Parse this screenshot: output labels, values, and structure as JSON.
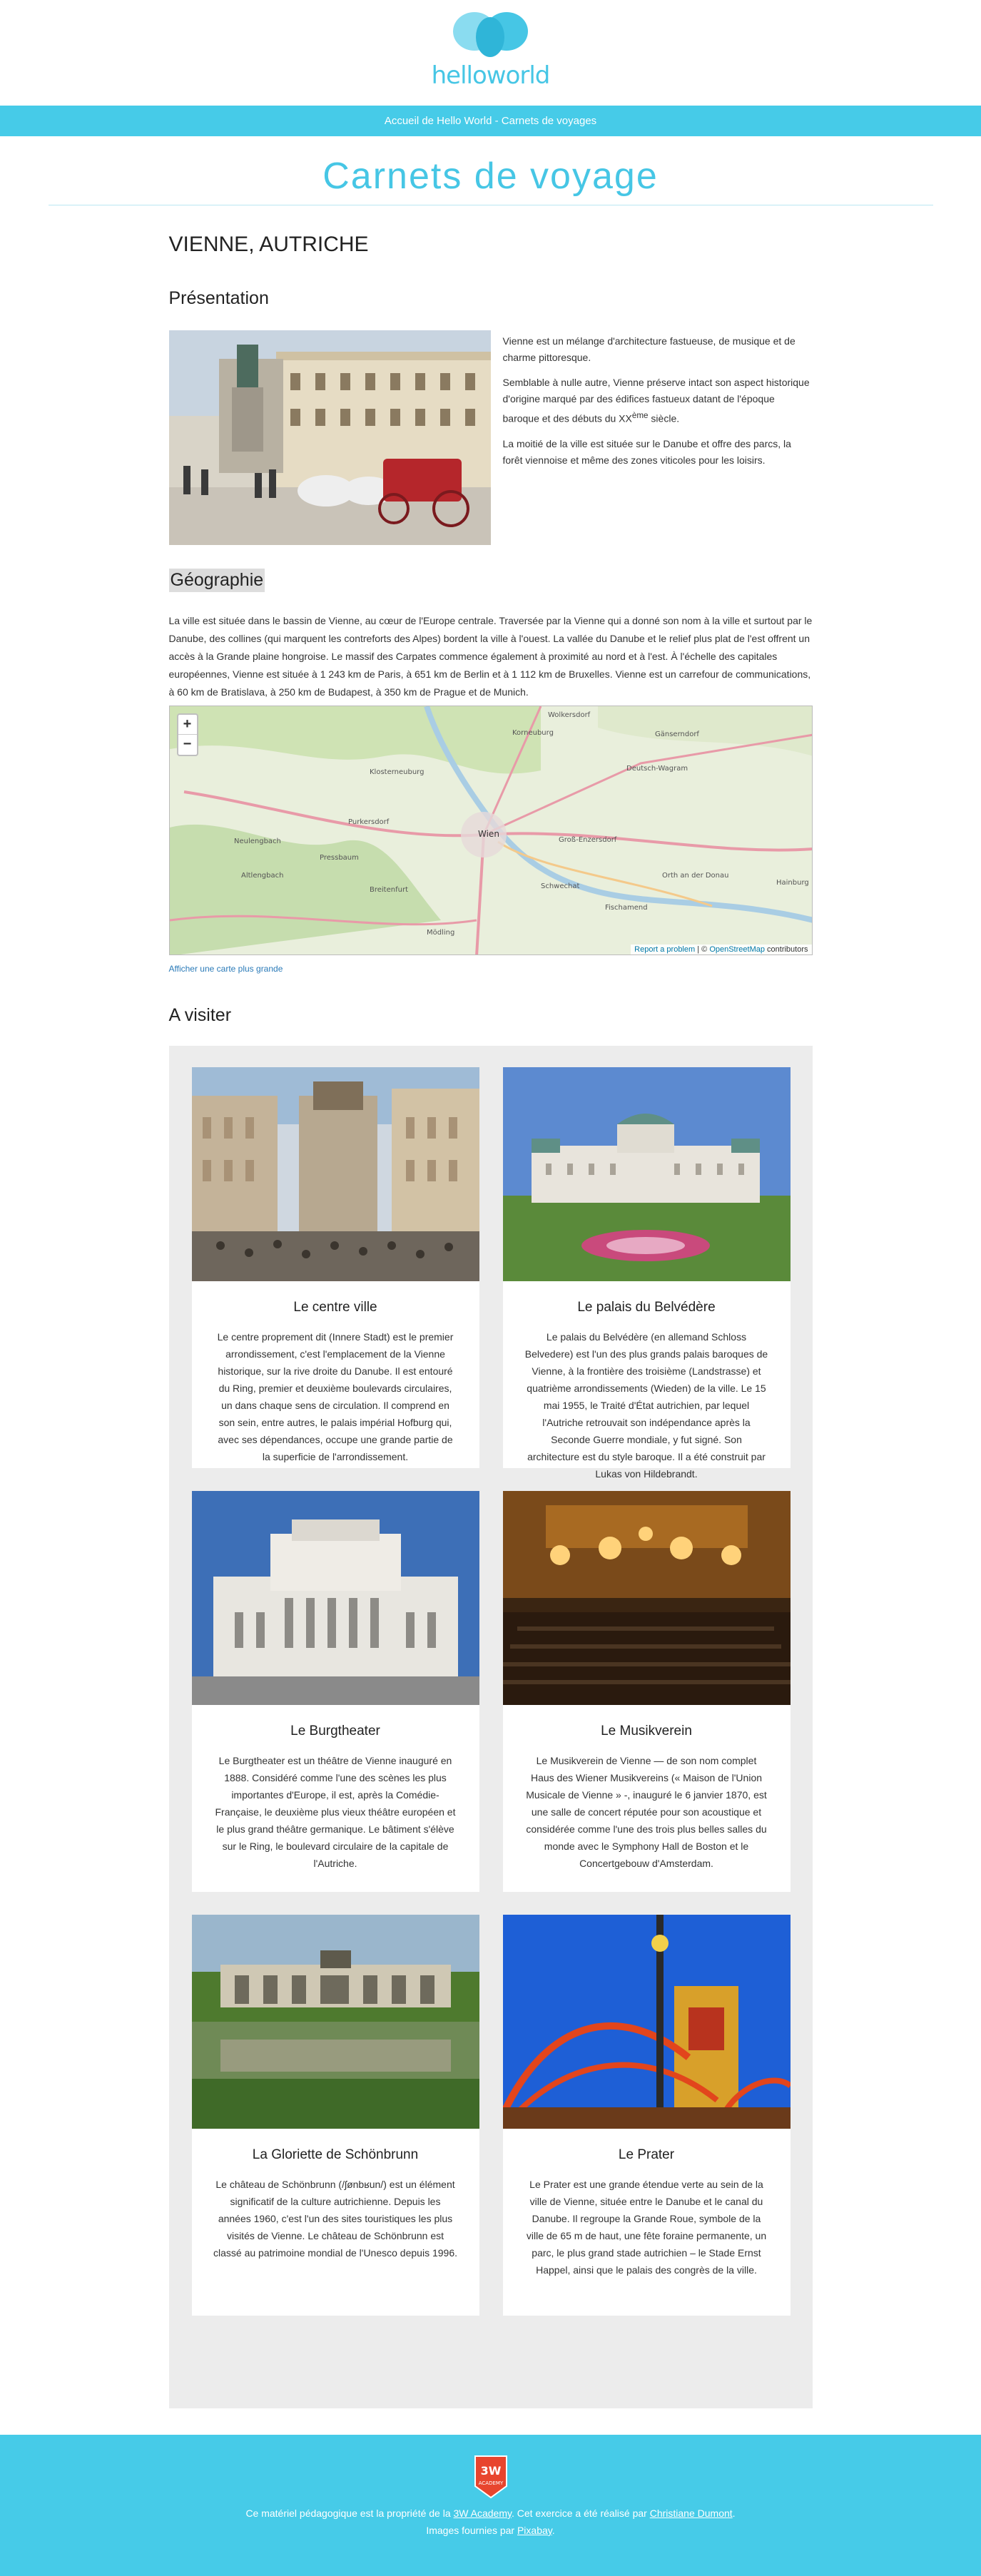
{
  "brand": {
    "name": "helloworld",
    "accent": "#46c6e5"
  },
  "topbar": {
    "breadcrumb": "Accueil de Hello World - Carnets de voyages"
  },
  "page": {
    "title": "Carnets de voyage"
  },
  "city": {
    "name": "VIENNE, AUTRICHE"
  },
  "presentation": {
    "heading": "Présentation",
    "p1": "Vienne est un mélange d'architecture fastueuse, de musique et de charme pittoresque.",
    "p2a": "Semblable à nulle autre, Vienne préserve intact son aspect historique d'origine marqué par des édifices fastueux datant de l'époque baroque et des débuts du XX",
    "p2sup": "ème",
    "p2b": " siècle.",
    "p3": "La moitié de la ville est située sur le Danube et offre des parcs, la forêt viennoise et même des zones viticoles pour les loisirs."
  },
  "geographie": {
    "heading": "Géographie",
    "text": "La ville est située dans le bassin de Vienne, au cœur de l'Europe centrale. Traversée par la Vienne qui a donné son nom à la ville et surtout par le Danube, des collines (qui marquent les contreforts des Alpes) bordent la ville à l'ouest. La vallée du Danube et le relief plus plat de l'est offrent un accès à la Grande plaine hongroise. Le massif des Carpates commence également à proximité au nord et à l'est. À l'échelle des capitales européennes, Vienne est située à 1 243 km de Paris, à 651 km de Berlin et à 1 112 km de Bruxelles. Vienne est un carrefour de communications, à 60 km de Bratislava, à 250 km de Budapest, à 350 km de Prague et de Munich."
  },
  "map": {
    "zoom_in": "+",
    "zoom_out": "−",
    "report": "Report a problem",
    "sep": " | © ",
    "osm": "OpenStreetMap",
    "contrib": " contributors",
    "labels": [
      "Wien",
      "Korneuburg",
      "Klosterneuburg",
      "Gänserndorf",
      "Deutsch-Wagram",
      "Purkersdorf",
      "Neulengbach",
      "Pressbaum",
      "Altlengbach",
      "Breitenfurt",
      "Mödling",
      "Schwechat",
      "Groß-Enzersdorf",
      "Orth an der Donau",
      "Fischamend",
      "Hainburg",
      "Wolkersdorf"
    ],
    "link": "Afficher une carte plus grande"
  },
  "visiter": {
    "heading": "A visiter",
    "cards": [
      {
        "title": "Le centre ville",
        "text": "Le centre proprement dit (Innere Stadt) est le premier arrondissement, c'est l'emplacement de la Vienne historique, sur la rive droite du Danube. Il est entouré du Ring, premier et deuxième boulevards circulaires, un dans chaque sens de circulation. Il comprend en son sein, entre autres, le palais impérial Hofburg qui, avec ses dépendances, occupe une grande partie de la superficie de l'arrondissement."
      },
      {
        "title": "Le palais du Belvédère",
        "text": "Le palais du Belvédère (en allemand Schloss Belvedere) est l'un des plus grands palais baroques de Vienne, à la frontière des troisième (Landstrasse) et quatrième arrondissements (Wieden) de la ville. Le 15 mai 1955, le Traité d'État autrichien, par lequel l'Autriche retrouvait son indépendance après la Seconde Guerre mondiale, y fut signé. Son architecture est du style baroque. Il a été construit par Lukas von Hildebrandt."
      },
      {
        "title": "Le Burgtheater",
        "text": "Le Burgtheater est un théâtre de Vienne inauguré en 1888. Considéré comme l'une des scènes les plus importantes d'Europe, il est, après la Comédie-Française, le deuxième plus vieux théâtre européen et le plus grand théâtre germanique. Le bâtiment s'élève sur le Ring, le boulevard circulaire de la capitale de l'Autriche."
      },
      {
        "title": "Le Musikverein",
        "text": "Le Musikverein de Vienne — de son nom complet Haus des Wiener Musikvereins (« Maison de l'Union Musicale de Vienne » -, inauguré le 6 janvier 1870, est une salle de concert réputée pour son acoustique et considérée comme l'une des trois plus belles salles du monde avec le Symphony Hall de Boston et le Concertgebouw d'Amsterdam."
      },
      {
        "title": "La Gloriette de Schönbrunn",
        "text": "Le château de Schönbrunn (/ʃønbʁun/) est un élément significatif de la culture autrichienne. Depuis les années 1960, c'est l'un des sites touristiques les plus visités de Vienne. Le château de Schönbrunn est classé au patrimoine mondial de l'Unesco depuis 1996."
      },
      {
        "title": "Le Prater",
        "text": "Le Prater est une grande étendue verte au sein de la ville de Vienne, située entre le Danube et le canal du Danube. Il regroupe la Grande Roue, symbole de la ville de 65 m de haut, une fête foraine permanente, un parc, le plus grand stade autrichien – le Stade Ernst Happel, ainsi que le palais des congrès de la ville."
      }
    ]
  },
  "footer": {
    "badge_top": "3W",
    "badge_bottom": "ACADEMY",
    "t1": "Ce matériel pédagogique est la propriété de la ",
    "l1": "3W Academy",
    "t2": ". Cet exercice a été réalisé par ",
    "l2": "Christiane Dumont",
    "t3": ".",
    "t4": "Images fournies par ",
    "l3": "Pixabay",
    "t5": "."
  }
}
